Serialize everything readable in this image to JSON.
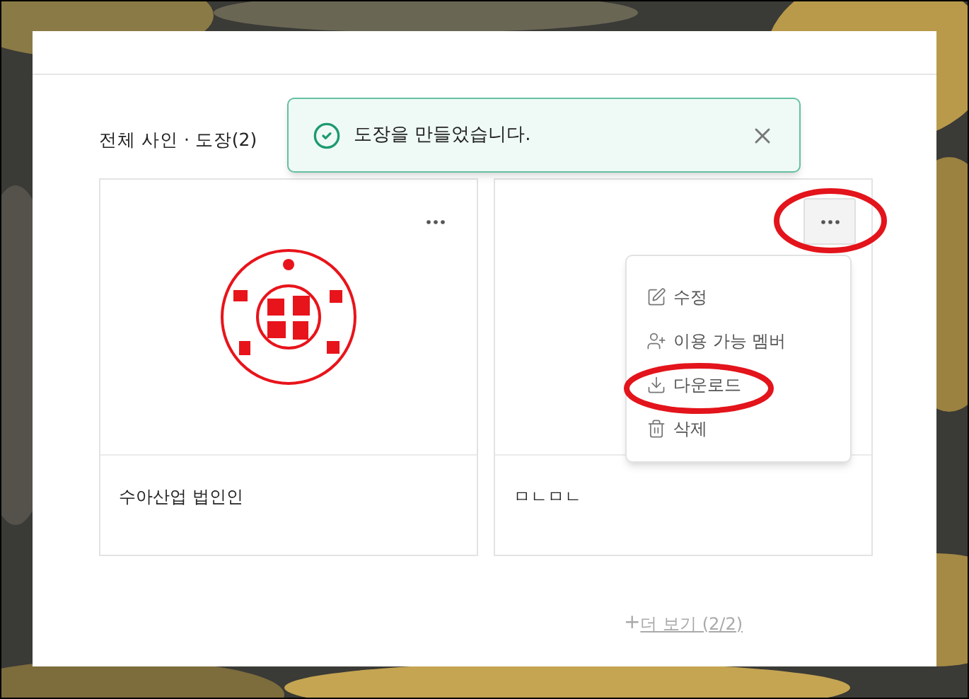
{
  "section_title": "전체 사인 · 도장(2)",
  "toast": {
    "message": "도장을 만들었습니다."
  },
  "cards": [
    {
      "name": "수아산업 법인인",
      "kind": "seal",
      "menu_open": false
    },
    {
      "name": "ㅁㄴㅁㄴ",
      "kind": "blank",
      "menu_open": true
    }
  ],
  "menu": [
    {
      "label": "수정"
    },
    {
      "label": "이용 가능 멤버"
    },
    {
      "label": "다운로드"
    },
    {
      "label": "삭제"
    }
  ],
  "more_link": {
    "icon": "+",
    "label": "더 보기 (2/2)"
  }
}
